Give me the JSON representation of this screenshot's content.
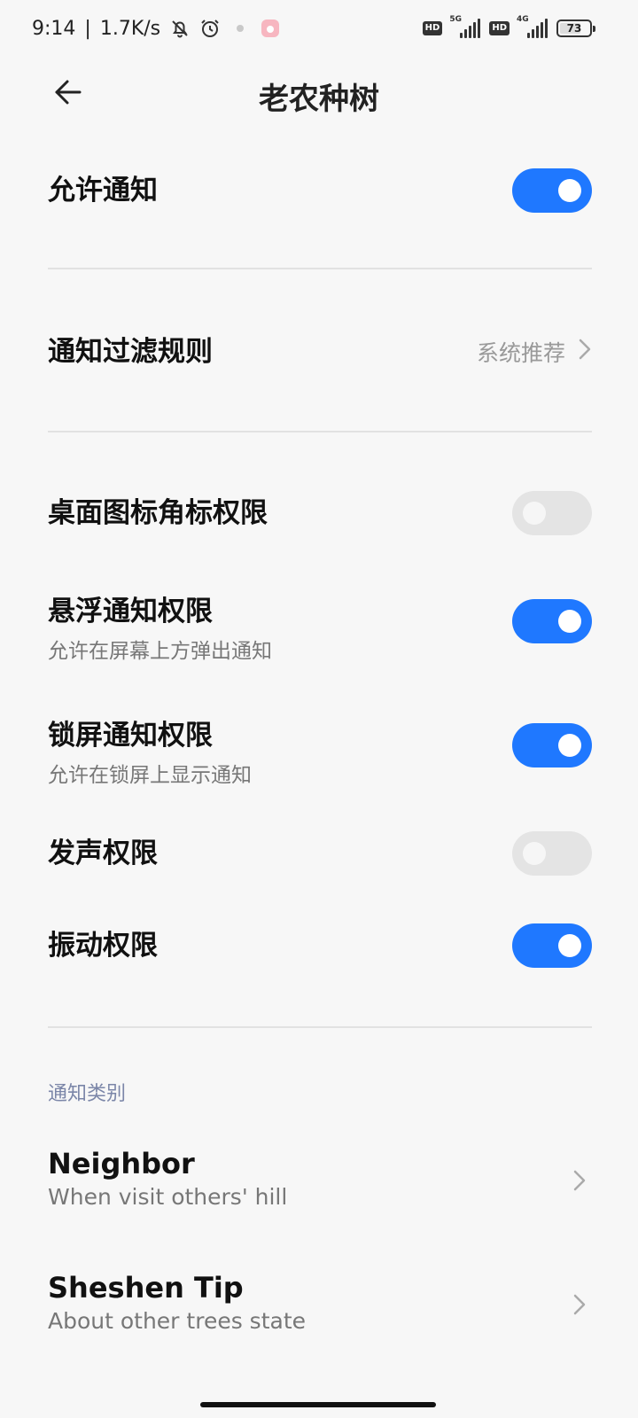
{
  "status_bar": {
    "time": "9:14",
    "separator": "|",
    "net_speed": "1.7K/s",
    "hd1": "HD",
    "net1": "5G",
    "hd2": "HD",
    "net2": "4G",
    "battery_text": "73",
    "battery_level": 0.73,
    "icons": [
      "bell-off-icon",
      "alarm-icon",
      "notification-dot-icon",
      "app-icon"
    ]
  },
  "header": {
    "title": "老农种树",
    "back_icon": "arrow-left-icon"
  },
  "settings": {
    "allow_notifications": {
      "label": "允许通知",
      "on": true
    },
    "filter_rule": {
      "label": "通知过滤规则",
      "value": "系统推荐"
    },
    "badge_permission": {
      "label": "桌面图标角标权限",
      "on": false
    },
    "floating_permission": {
      "label": "悬浮通知权限",
      "sub": "允许在屏幕上方弹出通知",
      "on": true
    },
    "lockscreen_permission": {
      "label": "锁屏通知权限",
      "sub": "允许在锁屏上显示通知",
      "on": true
    },
    "sound_permission": {
      "label": "发声权限",
      "on": false
    },
    "vibration_permission": {
      "label": "振动权限",
      "on": true
    }
  },
  "categories": {
    "label": "通知类别",
    "items": [
      {
        "title": "Neighbor",
        "sub": "When visit others' hill"
      },
      {
        "title": "Sheshen Tip",
        "sub": "About other trees state"
      }
    ]
  },
  "colors": {
    "accent": "#1f78ff",
    "toggle_off": "#e4e4e4",
    "section_label": "#7b86a8"
  }
}
